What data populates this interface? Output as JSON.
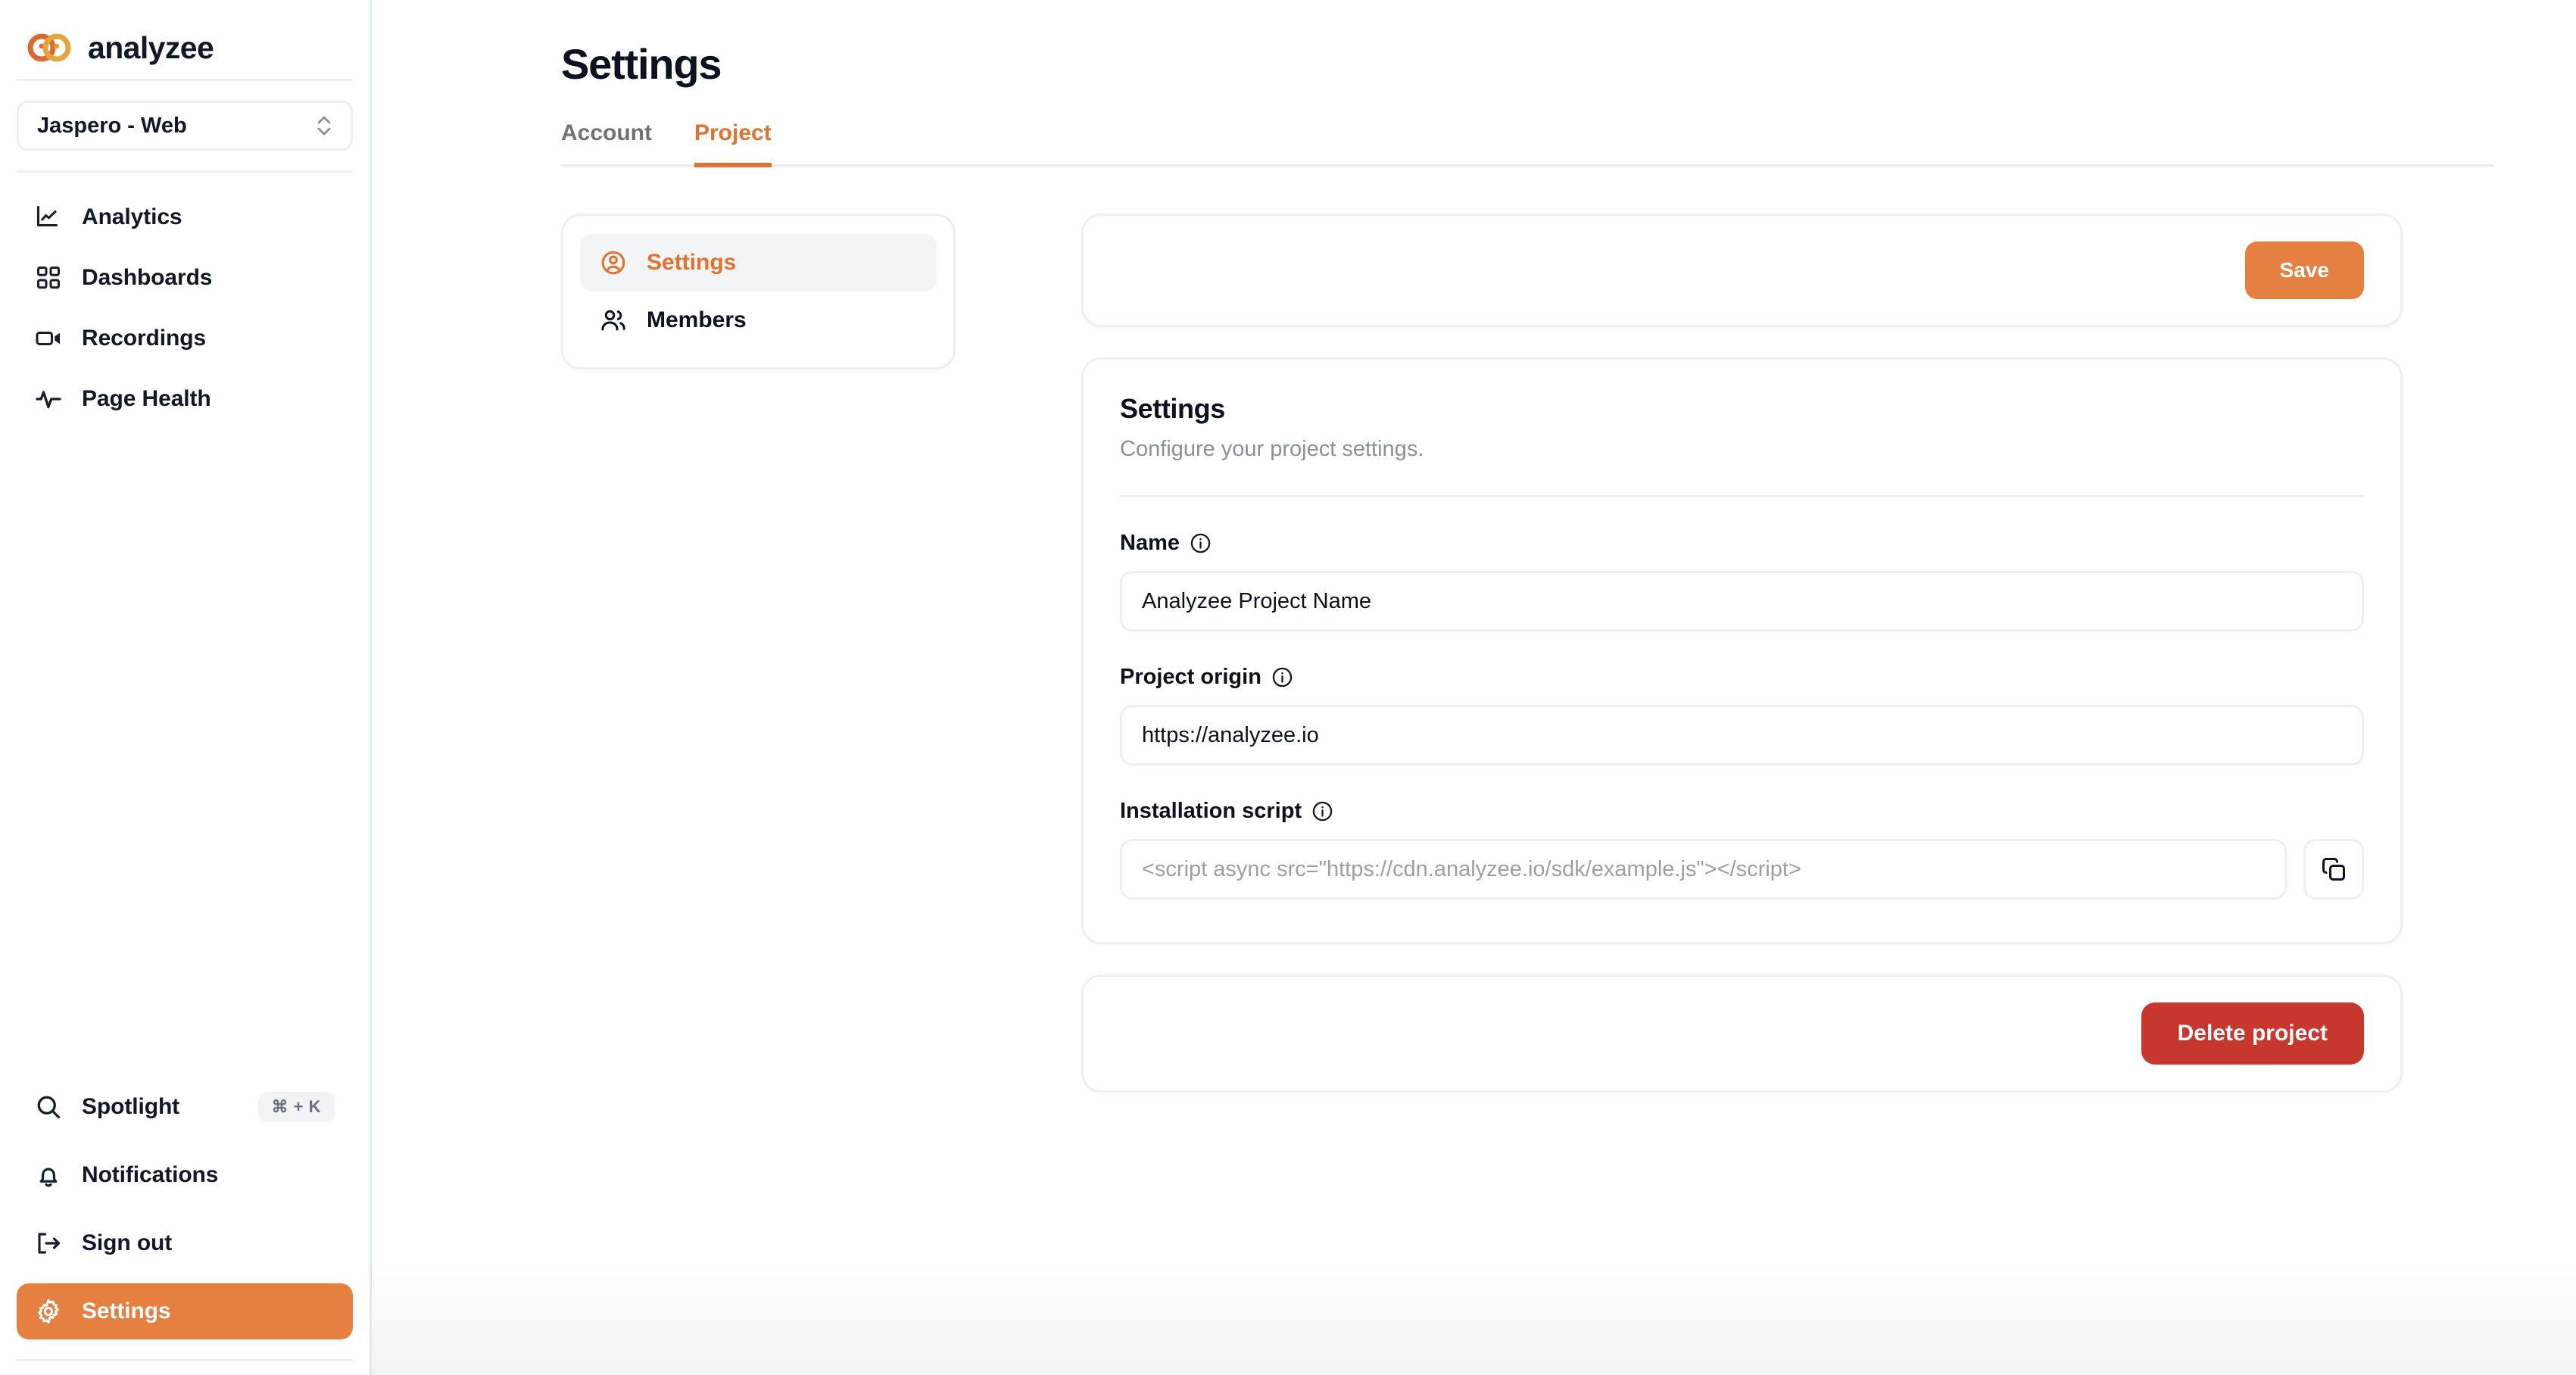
{
  "brand": {
    "name": "analyzee",
    "logo_icon": "infinity-rings-logo",
    "colors": {
      "logo_left": "#d96a33",
      "logo_right": "#e8a33d"
    }
  },
  "project_selector": {
    "value": "Jaspero - Web",
    "icon": "chevron-up-down-icon"
  },
  "sidebar": {
    "main_items": [
      {
        "label": "Analytics",
        "icon": "line-chart-icon",
        "active": false
      },
      {
        "label": "Dashboards",
        "icon": "layout-grid-icon",
        "active": false
      },
      {
        "label": "Recordings",
        "icon": "video-camera-icon",
        "active": false
      },
      {
        "label": "Page Health",
        "icon": "activity-pulse-icon",
        "active": false
      }
    ],
    "bottom_items": [
      {
        "label": "Spotlight",
        "icon": "search-icon",
        "shortcut": "⌘ + K",
        "active": false
      },
      {
        "label": "Notifications",
        "icon": "bell-icon",
        "shortcut": "",
        "active": false
      },
      {
        "label": "Sign out",
        "icon": "logout-icon",
        "shortcut": "",
        "active": false
      },
      {
        "label": "Settings",
        "icon": "gear-icon",
        "shortcut": "",
        "active": true
      }
    ]
  },
  "page": {
    "title": "Settings"
  },
  "tabs": [
    {
      "label": "Account",
      "active": false
    },
    {
      "label": "Project",
      "active": true
    }
  ],
  "subnav": [
    {
      "label": "Settings",
      "icon": "user-circle-icon",
      "active": true
    },
    {
      "label": "Members",
      "icon": "users-icon",
      "active": false
    }
  ],
  "save_bar": {
    "save_label": "Save"
  },
  "settings_card": {
    "title": "Settings",
    "subtitle": "Configure your project settings.",
    "fields": {
      "name": {
        "label": "Name",
        "info_icon": "info-circle-icon",
        "value": "Analyzee Project Name",
        "placeholder": "Analyzee Project Name"
      },
      "origin": {
        "label": "Project origin",
        "info_icon": "info-circle-icon",
        "value": "https://analyzee.io",
        "placeholder": "https://analyzee.io"
      },
      "script": {
        "label": "Installation script",
        "info_icon": "info-circle-icon",
        "value": "",
        "placeholder": "<script async src=\"https://cdn.analyzee.io/sdk/example.js\"></script>",
        "copy_icon": "copy-icon"
      }
    }
  },
  "danger_card": {
    "delete_label": "Delete project"
  },
  "colors": {
    "accent": "#e58041",
    "accent_text": "#e0712f",
    "danger": "#c8372d",
    "text": "#0b1220",
    "muted": "#8a9099",
    "border": "#eceff3"
  }
}
